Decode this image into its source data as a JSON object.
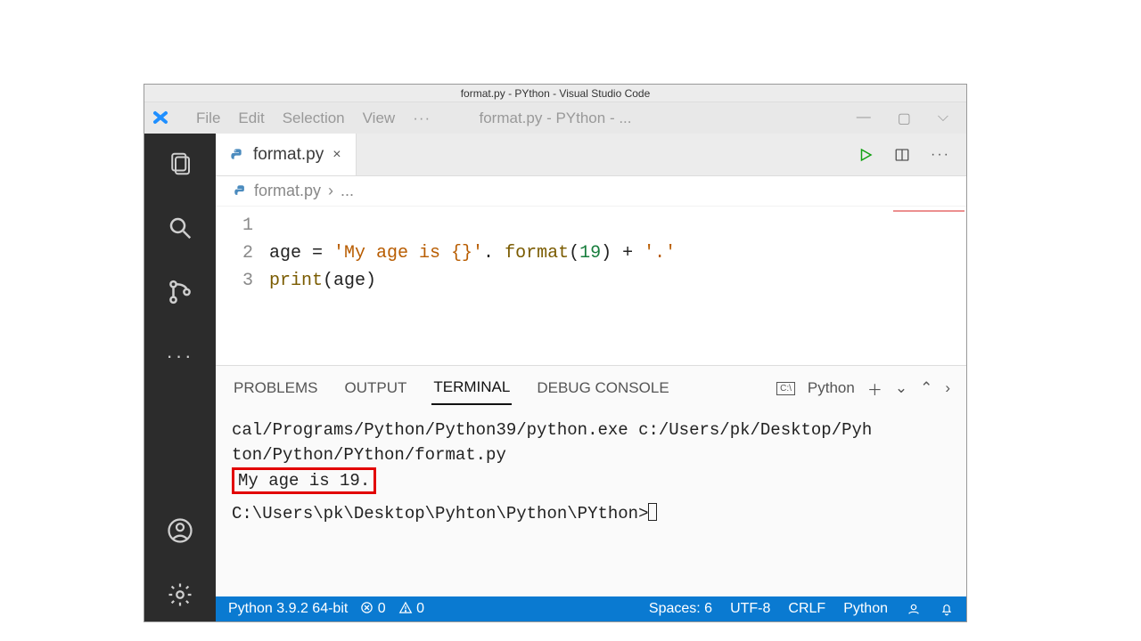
{
  "outer_title": "format.py - PYthon - Visual Studio Code",
  "menu": {
    "file": "File",
    "edit": "Edit",
    "selection": "Selection",
    "view": "View",
    "dots": "···",
    "trunc_title": "format.py - PYthon - ..."
  },
  "tab": {
    "filename": "format.py",
    "close": "×"
  },
  "breadcrumb": {
    "file": "format.py",
    "sep": "›",
    "more": "..."
  },
  "code": {
    "lines": [
      "1",
      "2",
      "3"
    ],
    "l1": {
      "a": "age = ",
      "s1": "'My age is {}'",
      "b": ". ",
      "fn": "format",
      "c": "(",
      "num": "19",
      "d": ") + ",
      "s2": "'.'"
    },
    "l2": {
      "a": "print",
      "b": "(age)"
    }
  },
  "panel": {
    "tabs": {
      "problems": "PROBLEMS",
      "output": "OUTPUT",
      "terminal": "TERMINAL",
      "debug": "DEBUG CONSOLE"
    },
    "shell_label": "Python"
  },
  "terminal": {
    "line1": "cal/Programs/Python/Python39/python.exe c:/Users/pk/Desktop/Pyh",
    "line2": "ton/Python/PYthon/format.py",
    "output": "My age is 19.",
    "prompt": "C:\\Users\\pk\\Desktop\\Pyhton\\Python\\PYthon>"
  },
  "status": {
    "interpreter": "Python 3.9.2 64-bit",
    "errors": "0",
    "warnings": "0",
    "spaces": "Spaces: 6",
    "encoding": "UTF-8",
    "eol": "CRLF",
    "lang": "Python"
  }
}
